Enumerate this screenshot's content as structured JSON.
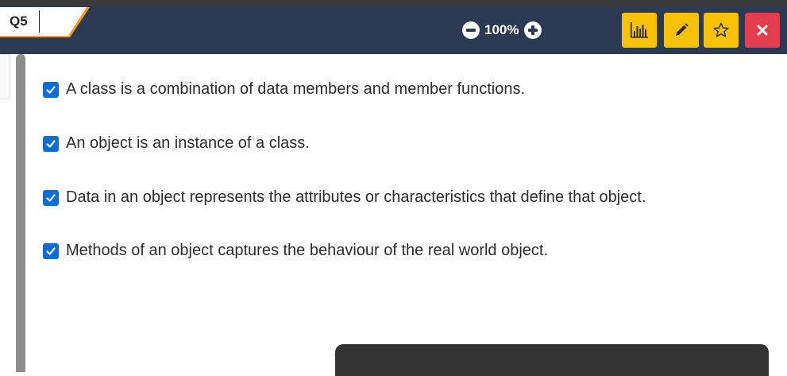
{
  "question": {
    "label": "Q5"
  },
  "zoom": {
    "value": "100%"
  },
  "toolbar": {
    "stats_icon": "bar-chart-icon",
    "edit_icon": "pencil-icon",
    "star_icon": "star-outline-icon",
    "close_icon": "close-icon"
  },
  "options": [
    {
      "text": "A class is a combination of data members and member functions.",
      "checked": true
    },
    {
      "text": "An object is an instance of a class.",
      "checked": true
    },
    {
      "text": "Data in an object represents the attributes or characteristics that define that object.",
      "checked": true
    },
    {
      "text": "Methods of an object captures the behaviour of the real world object.",
      "checked": true
    }
  ],
  "colors": {
    "header": "#2b3a52",
    "accent": "#f7c106",
    "tab_orange": "#f0a30a",
    "danger": "#e43d4e",
    "checkbox": "#0b6ed7"
  }
}
